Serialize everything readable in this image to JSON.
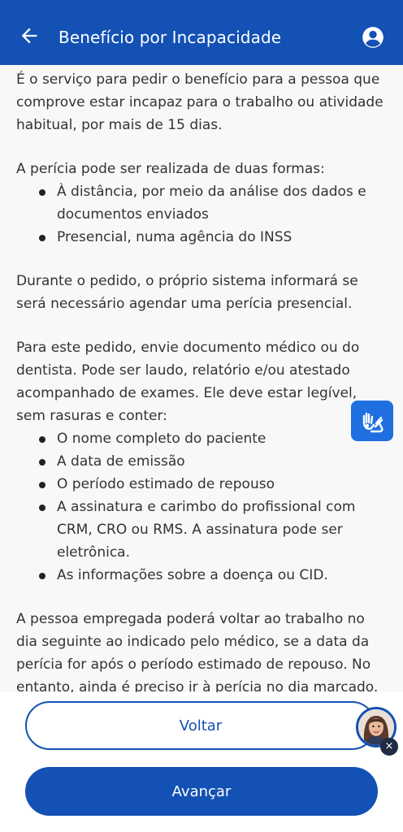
{
  "header": {
    "title": "Benefício por Incapacidade",
    "back_icon": "arrow-left-icon",
    "profile_icon": "user-circle-icon",
    "background": "#1351b4"
  },
  "content": {
    "intro": "É o serviço para pedir o benefício para a pessoa que comprove estar incapaz para o trabalho ou atividade habitual, por mais de 15 dias.",
    "pericia_intro": "A perícia pode ser realizada de duas formas:",
    "pericia_items": [
      "À distância, por meio da análise dos dados e documentos enviados",
      "Presencial, numa agência do INSS"
    ],
    "durante": "Durante o pedido, o próprio sistema informará se será necessário agendar uma perícia presencial.",
    "documento_intro": "Para este pedido, envie documento médico ou do dentista. Pode ser laudo, relatório e/ou atestado acompanhado de exames. Ele deve estar legível, sem rasuras e conter:",
    "documento_items": [
      "O nome completo do paciente",
      "A data de emissão",
      "O período estimado de repouso",
      "A assinatura e carimbo do profissional com CRM, CRO ou RMS. A assinatura pode ser eletrônica.",
      "As informações sobre a doença ou CID."
    ],
    "empregada": "A pessoa empregada poderá voltar ao trabalho no dia seguinte ao indicado pelo médico, se a data da perícia for após o período estimado de repouso. No entanto, ainda é preciso ir à perícia no dia marcado."
  },
  "accessibility": {
    "icon": "sign-language-hands-icon",
    "color": "#1f6fe0"
  },
  "footer": {
    "back_label": "Voltar",
    "next_label": "Avançar",
    "assistant_icon": "virtual-assistant-avatar-icon",
    "close_icon": "close-icon",
    "close_symbol": "×"
  }
}
